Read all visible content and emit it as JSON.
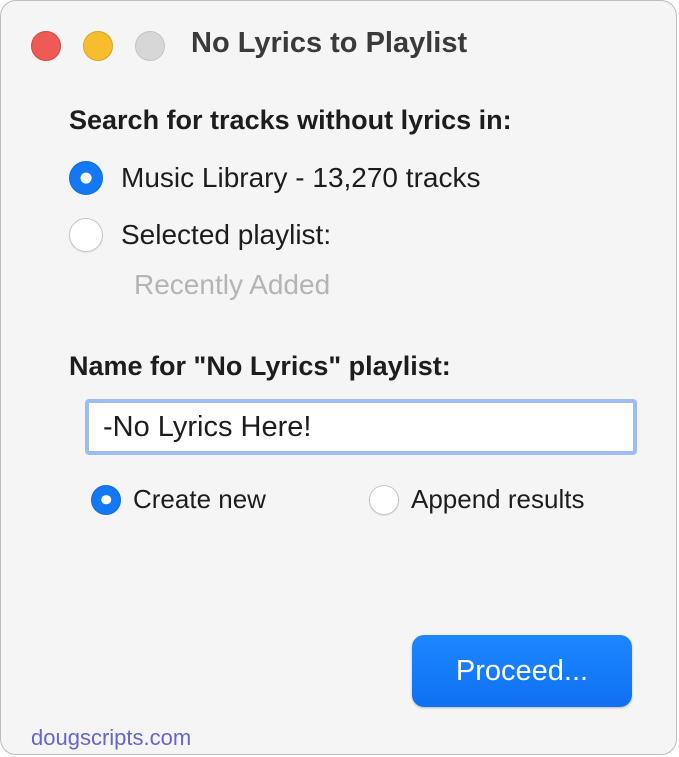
{
  "window": {
    "title": "No Lyrics to Playlist"
  },
  "search_section": {
    "heading": "Search for tracks without lyrics in:",
    "options": [
      {
        "label": "Music Library - 13,270 tracks",
        "selected": true
      },
      {
        "label": "Selected playlist:",
        "selected": false
      }
    ],
    "selected_playlist_name": "Recently Added"
  },
  "name_section": {
    "heading": "Name for \"No Lyrics\" playlist:",
    "field_value": "-No Lyrics Here!",
    "options": [
      {
        "label": "Create new",
        "selected": true
      },
      {
        "label": "Append results",
        "selected": false
      }
    ]
  },
  "actions": {
    "proceed_label": "Proceed..."
  },
  "footer": {
    "link_text": "dougscripts.com"
  },
  "colors": {
    "accent": "#1478f5",
    "close": "#ee5b57",
    "minimize": "#f6be2f",
    "zoom_disabled": "#d7d7d7",
    "link": "#6466d0"
  }
}
